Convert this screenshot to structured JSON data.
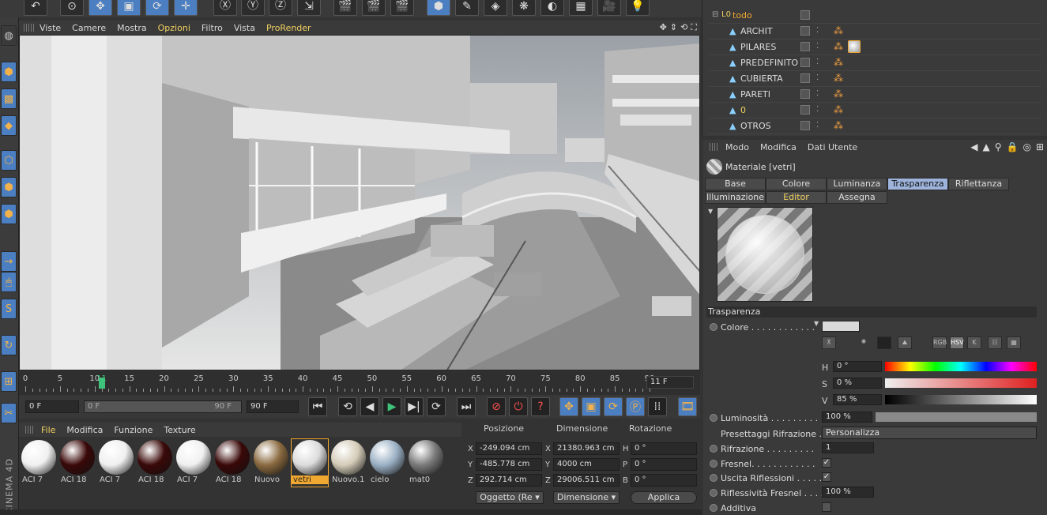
{
  "viewport": {
    "menu": [
      "Viste",
      "Camere",
      "Mostra",
      "Opzioni",
      "Filtro",
      "Vista",
      "ProRender"
    ]
  },
  "timeline": {
    "ticks": [
      "0",
      "5",
      "10",
      "11",
      "15",
      "20",
      "25",
      "30",
      "35",
      "40",
      "45",
      "50",
      "55",
      "60",
      "65",
      "70",
      "75",
      "80",
      "85",
      "90"
    ],
    "current_frame": "11 F",
    "playhead_frame": 11,
    "range_max": 90
  },
  "transport": {
    "start": "0 F",
    "slider_start": "0 F",
    "slider_end": "90 F",
    "end": "90 F"
  },
  "materials": {
    "menu": [
      "File",
      "Modifica",
      "Funzione",
      "Texture"
    ],
    "items": [
      {
        "name": "ACI 7",
        "color": "#f0f0f0"
      },
      {
        "name": "ACI 18",
        "color": "#3a0808"
      },
      {
        "name": "ACI 7",
        "color": "#f0f0f0"
      },
      {
        "name": "ACI 18",
        "color": "#3a0808"
      },
      {
        "name": "ACI 7",
        "color": "#f0f0f0"
      },
      {
        "name": "ACI 18",
        "color": "#3a0808"
      },
      {
        "name": "Nuovo",
        "color": "#8a6a40"
      },
      {
        "name": "vetri",
        "color": "#dcdcdc"
      },
      {
        "name": "Nuovo.1",
        "color": "#d4cbb8"
      },
      {
        "name": "cielo",
        "color": "#9ab0c4"
      },
      {
        "name": "mat0",
        "color": "#7a7a7a"
      }
    ]
  },
  "coords": {
    "headers": [
      "Posizione",
      "Dimensione",
      "Rotazione"
    ],
    "rows": [
      {
        "axis": "X",
        "pos": "-249.094 cm",
        "dim_axis": "X",
        "dim": "21380.963 cm",
        "rot_axis": "H",
        "rot": "0 °"
      },
      {
        "axis": "Y",
        "pos": "-485.778 cm",
        "dim_axis": "Y",
        "dim": "4000 cm",
        "rot_axis": "P",
        "rot": "0 °"
      },
      {
        "axis": "Z",
        "pos": "292.714 cm",
        "dim_axis": "Z",
        "dim": "29006.511 cm",
        "rot_axis": "B",
        "rot": "0 °"
      }
    ],
    "mode": "Oggetto (Re",
    "dim_mode": "Dimensione",
    "apply": "Applica"
  },
  "objects": {
    "root": "todo",
    "items": [
      "ARCHIT",
      "PILARES",
      "PREDEFINITO",
      "CUBIERTA",
      "PARETI",
      "0",
      "OTROS"
    ]
  },
  "attributes": {
    "menu": [
      "Modo",
      "Modifica",
      "Dati Utente"
    ],
    "material_title": "Materiale [vetri]",
    "tabs_row1": [
      "Base",
      "Colore",
      "Luminanza",
      "Trasparenza",
      "Riflettanza"
    ],
    "tabs_row2": [
      "Illuminazione",
      "Editor",
      "Assegna"
    ],
    "section": "Trasparenza",
    "color_label": "Colore . . . . . . . . . . . .",
    "color_modes": [
      "RGB",
      "HSV",
      "K"
    ],
    "hsv": [
      {
        "label": "H",
        "value": "0 °"
      },
      {
        "label": "S",
        "value": "0 %"
      },
      {
        "label": "V",
        "value": "85 %"
      }
    ],
    "luminosita_label": "Luminosità . . . . . . . . .",
    "luminosita_value": "100 %",
    "luminosita_level": 1.0,
    "preset_label": "Presettaggi Rifrazione .",
    "preset_value": "Personalizza",
    "rifrazione_label": "Rifrazione . . . . . . . . .",
    "rifrazione_value": "1",
    "fresnel_label": "Fresnel. . . . . . . . . . . .",
    "uscita_label": "Uscita Riflessioni . . . . .",
    "riflessivita_label": "Riflessività Fresnel . . . .",
    "riflessivita_value": "100 %",
    "additiva_label": "Additiva"
  }
}
